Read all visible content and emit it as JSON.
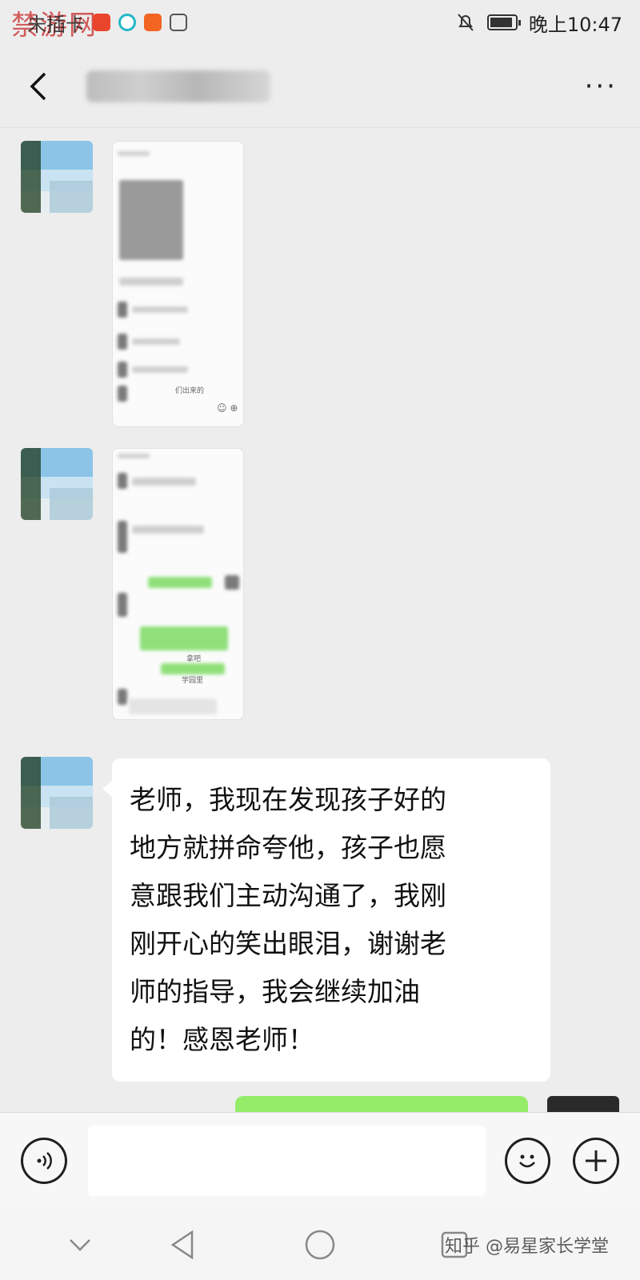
{
  "watermark_top": "禁游网",
  "status_bar": {
    "carrier": "未插卡",
    "time": "晚上10:47",
    "battery_level": 0.8,
    "app_icon_colors": [
      "#e8452c",
      "#25b7c7",
      "#f26522",
      "#555555"
    ]
  },
  "title_bar": {
    "back_icon": "chevron-left-icon",
    "more_label": "···"
  },
  "messages": [
    {
      "type": "image",
      "direction": "incoming",
      "caption": "们出来的"
    },
    {
      "type": "image",
      "direction": "incoming",
      "labels": [
        "拿吧",
        "学园里"
      ]
    },
    {
      "type": "text",
      "direction": "incoming",
      "lines": [
        "老师，我现在发现孩子好的",
        "地方就拼命夸他，孩子也愿",
        "意跟我们主动沟通了，我刚",
        "刚开心的笑出眼泪，谢谢老",
        "师的指导，我会继续加油",
        "的！感恩老师！"
      ]
    },
    {
      "type": "text",
      "direction": "outgoing",
      "color": "#95ec69"
    }
  ],
  "input_bar": {
    "voice_icon": "voice-icon",
    "emoji_icon": "emoji-icon",
    "plus_icon": "plus-icon"
  },
  "watermark_bottom": "知乎 @易星家长学堂"
}
